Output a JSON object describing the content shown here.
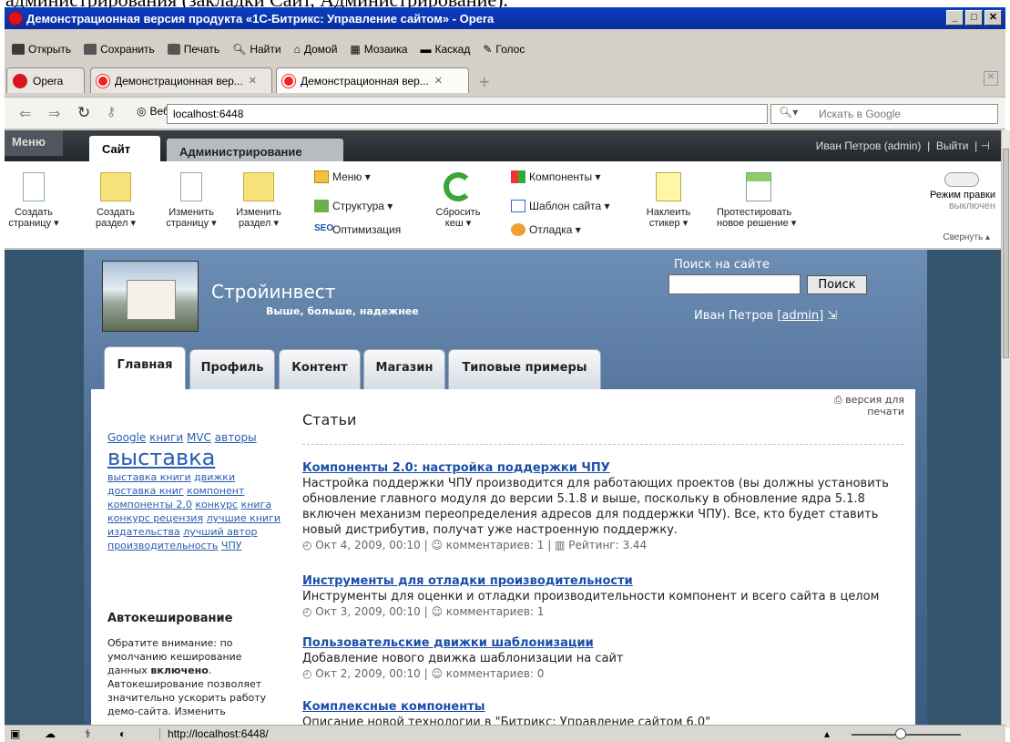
{
  "caption_text": "администрирования (закладки Сайт, Администрирование).",
  "window": {
    "title": "Демонстрационная версия продукта «1С-Битрикс: Управление сайтом» - Opera",
    "min": "_",
    "max": "□",
    "close": "✕"
  },
  "toolbar": {
    "open": "Открыть",
    "save": "Сохранить",
    "print": "Печать",
    "find": "Найти",
    "home": "Домой",
    "tile": "Мозаика",
    "cascade": "Каскад",
    "voice": "Голос"
  },
  "tabs": {
    "opera": "Opera",
    "tab1": "Демонстрационная вер...",
    "tab2": "Демонстрационная вер..."
  },
  "address": {
    "web_label": "Веб",
    "url": "localhost:6448",
    "search_placeholder": "Искать в Google"
  },
  "panel": {
    "menu": "Меню",
    "tab_site": "Сайт",
    "tab_admin": "Администрирование",
    "user": "Иван Петров (admin)",
    "logout": "Выйти"
  },
  "ribbon": {
    "create_page": [
      "Создать",
      "страницу ▾"
    ],
    "create_section": [
      "Создать",
      "раздел ▾"
    ],
    "edit_page": [
      "Изменить",
      "страницу ▾"
    ],
    "edit_section": [
      "Изменить",
      "раздел ▾"
    ],
    "menu": "Меню ▾",
    "structure": "Структура ▾",
    "seo": "Оптимизация",
    "reset_cache": [
      "Сбросить",
      "кеш ▾"
    ],
    "components": "Компоненты ▾",
    "template": "Шаблон сайта ▾",
    "debug": "Отладка ▾",
    "sticker": [
      "Наклеить",
      "стикер ▾"
    ],
    "test": [
      "Протестировать",
      "новое решение ▾"
    ],
    "edit_mode": "Режим правки",
    "edit_mode_state": "выключен",
    "collapse": "Свернуть ▴"
  },
  "site": {
    "name": "Стройинвест",
    "slogan": "Выше, больше, надежнее",
    "search_label": "Поиск на сайте",
    "search_button": "Поиск",
    "user_name": "Иван Петров [",
    "user_login": "admin",
    "user_close": "]",
    "tabs": [
      "Главная",
      "Профиль",
      "Контент",
      "Магазин",
      "Типовые примеры"
    ]
  },
  "sidebar": {
    "tags_line1": [
      "Google",
      "книги",
      "MVC",
      "авторы"
    ],
    "tag_big": "выставка",
    "tags_rest": [
      "выставка книги",
      "движки",
      "доставка книг",
      "компонент",
      "компоненты 2.0",
      "конкурс",
      "книга",
      "конкурс рецензия",
      "лучшие книги",
      "издательства",
      "лучший автор",
      "производительность",
      "ЧПУ"
    ],
    "autocache_title": "Автокеширование",
    "autocache_text_1": "Обратите внимание: по умолчанию кеширование данных ",
    "autocache_bold": "включено",
    "autocache_text_2": ". Автокеширование позволяет значительно ускорить работу демо-сайта. Изменить"
  },
  "main": {
    "title": "Статьи",
    "print_version": "версия для печати",
    "articles": [
      {
        "title": "Компоненты 2.0: настройка поддержки ЧПУ",
        "text": "Настройка поддержки ЧПУ производится для работающих проектов (вы должны установить обновление главного модуля до версии 5.1.8 и выше, поскольку в обновление ядра 5.1.8 включен механизм переопределения адресов для поддержки ЧПУ). Все, кто будет ставить новый дистрибутив, получат уже настроенную поддержку.",
        "meta": "◴ Окт 4, 2009, 00:10 | ☺ комментариев: 1 | ▥ Рейтинг: 3.44"
      },
      {
        "title": "Инструменты для отладки производительности",
        "text": "Инструменты для оценки и отладки производительности компонент и всего сайта в целом",
        "meta": "◴ Окт 3, 2009, 00:10 | ☺ комментариев: 1"
      },
      {
        "title": "Пользовательские движки шаблонизации",
        "text": "Добавление нового движка шаблонизации на сайт",
        "meta": "◴ Окт 2, 2009, 00:10 | ☺ комментариев: 0"
      },
      {
        "title": "Комплексные компоненты",
        "text": "Описание новой технологии в \"Битрикс: Управление сайтом 6.0\"",
        "meta": ""
      }
    ]
  },
  "status": {
    "url": "http://localhost:6448/"
  }
}
